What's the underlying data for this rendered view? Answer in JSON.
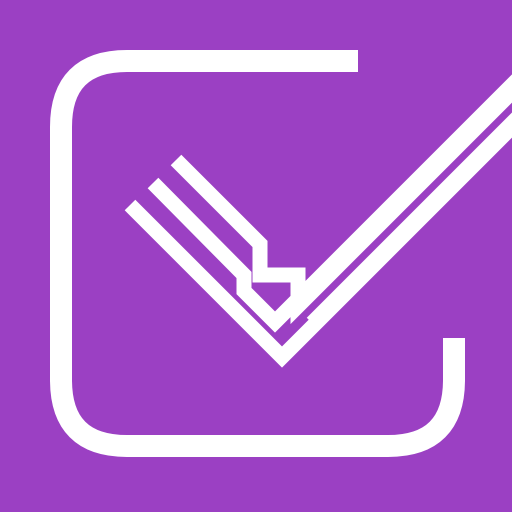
{
  "icon": {
    "name": "checklist-checkmark-icon",
    "background_color": "#9B40C3",
    "foreground_color": "#FFFFFF"
  }
}
